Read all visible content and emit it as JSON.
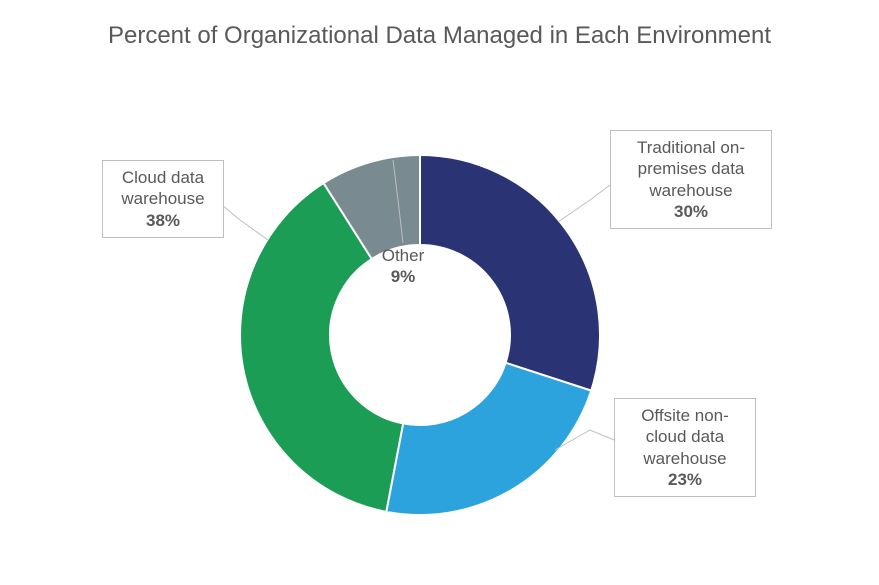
{
  "title": "Percent of Organizational Data Managed in Each Environment",
  "chart_data": {
    "type": "pie",
    "title": "Percent of Organizational Data Managed in Each Environment",
    "slices": [
      {
        "label": "Traditional on-premises data warehouse",
        "value": 30,
        "color": "#2a3374"
      },
      {
        "label": "Offsite non-cloud data warehouse",
        "value": 23,
        "color": "#2da3de"
      },
      {
        "label": "Cloud data warehouse",
        "value": 38,
        "color": "#1b9d55"
      },
      {
        "label": "Other",
        "value": 9,
        "color": "#7a8a91"
      }
    ]
  },
  "labels": {
    "traditional_l1": "Traditional on-",
    "traditional_l2": "premises data",
    "traditional_l3": "warehouse",
    "traditional_pct": "30%",
    "offsite_l1": "Offsite non-",
    "offsite_l2": "cloud data",
    "offsite_l3": "warehouse",
    "offsite_pct": "23%",
    "cloud_l1": "Cloud data",
    "cloud_l2": "warehouse",
    "cloud_pct": "38%",
    "other_l1": "Other",
    "other_pct": "9%"
  }
}
